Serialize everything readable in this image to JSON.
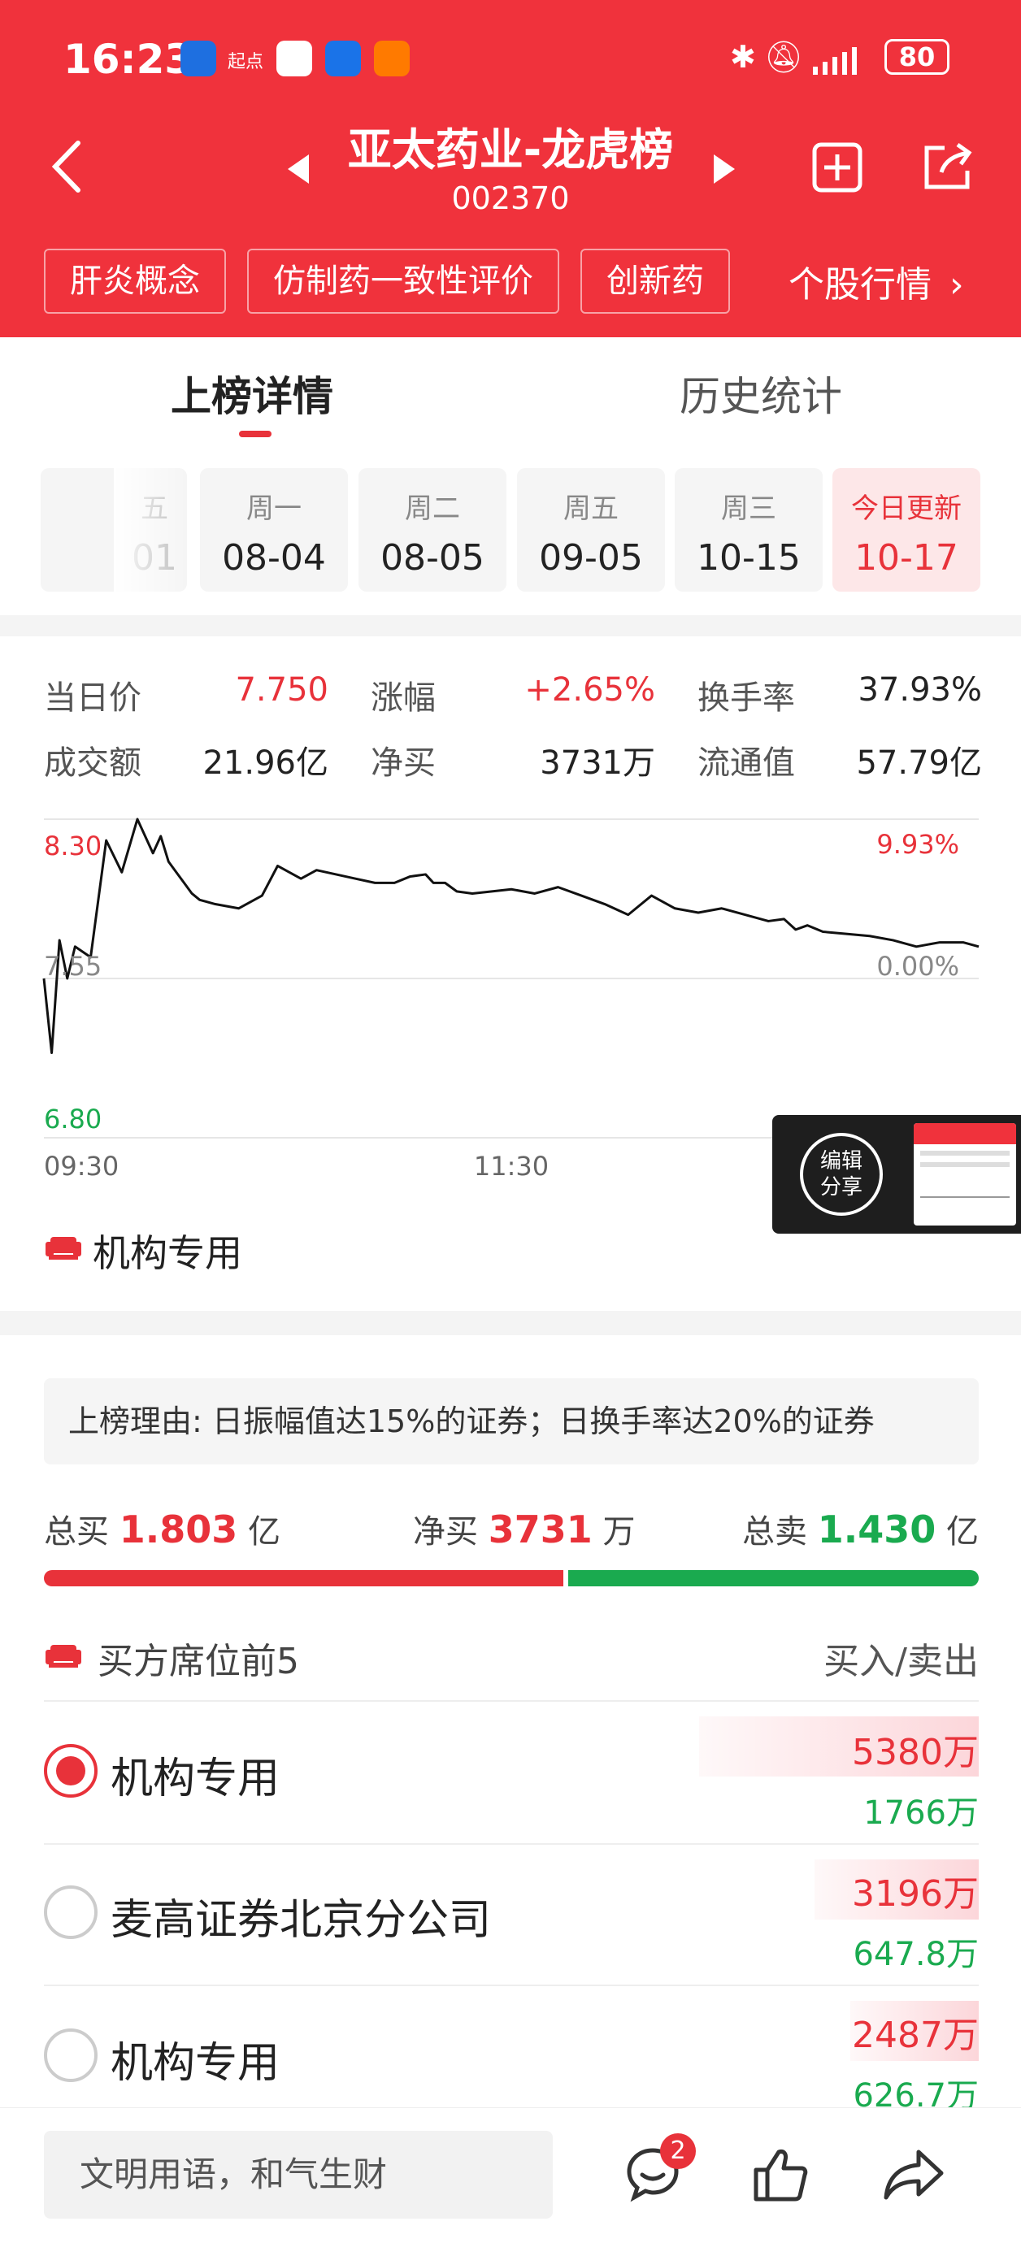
{
  "status_bar": {
    "time": "16:23",
    "app_icon_text": "起点",
    "battery": "80"
  },
  "header": {
    "title": "亚太药业-龙虎榜",
    "code": "002370",
    "tags": [
      "肝炎概念",
      "仿制药一致性评价",
      "创新药"
    ],
    "quote_link": "个股行情"
  },
  "tabs": [
    {
      "label": "上榜详情",
      "active": true
    },
    {
      "label": "历史统计",
      "active": false
    }
  ],
  "dates": [
    {
      "weekday": "五",
      "date": "01",
      "partial": true
    },
    {
      "weekday": "周一",
      "date": "08-04"
    },
    {
      "weekday": "周二",
      "date": "08-05"
    },
    {
      "weekday": "周五",
      "date": "09-05"
    },
    {
      "weekday": "周三",
      "date": "10-15"
    },
    {
      "weekday": "今日更新",
      "date": "10-17",
      "active": true
    }
  ],
  "stats": [
    {
      "label": "当日价",
      "value": "7.750",
      "color": "#e8323a"
    },
    {
      "label": "涨幅",
      "value": "+2.65%",
      "color": "#e8323a"
    },
    {
      "label": "换手率",
      "value": "37.93%",
      "color": "#222222"
    },
    {
      "label": "成交额",
      "value": "21.96亿",
      "color": "#222222"
    },
    {
      "label": "净买",
      "value": "3731万",
      "color": "#222222"
    },
    {
      "label": "流通值",
      "value": "57.79亿",
      "color": "#222222"
    }
  ],
  "chart_data": {
    "type": "line",
    "y_left_ticks": [
      "8.30",
      "7.55",
      "6.80"
    ],
    "y_right_ticks": [
      "9.93%",
      "0.00%"
    ],
    "x_ticks": [
      "09:30",
      "11:30"
    ],
    "ylim": [
      6.8,
      8.3
    ],
    "x_minutes": [
      0,
      2,
      4,
      6,
      8,
      12,
      16,
      20,
      24,
      28,
      30,
      32,
      34,
      36,
      38,
      40,
      44,
      50,
      56,
      60,
      66,
      70,
      75,
      80,
      85,
      90,
      94,
      98,
      100,
      103,
      106,
      110,
      115,
      120,
      126,
      132,
      138,
      144,
      150,
      156,
      162,
      168,
      174,
      180,
      186,
      190,
      193,
      196,
      200,
      206,
      212,
      218,
      224,
      230,
      236,
      238,
      240
    ],
    "prices": [
      7.55,
      7.2,
      7.73,
      7.55,
      7.7,
      7.65,
      8.2,
      8.05,
      8.3,
      8.14,
      8.22,
      8.1,
      8.05,
      8.0,
      7.95,
      7.92,
      7.9,
      7.88,
      7.94,
      8.08,
      8.02,
      8.06,
      8.04,
      8.02,
      8.0,
      8.0,
      8.03,
      8.04,
      8.0,
      8.0,
      7.96,
      7.95,
      7.96,
      7.97,
      7.95,
      7.98,
      7.94,
      7.9,
      7.85,
      7.94,
      7.88,
      7.86,
      7.88,
      7.85,
      7.82,
      7.83,
      7.78,
      7.8,
      7.77,
      7.76,
      7.75,
      7.73,
      7.7,
      7.72,
      7.72,
      7.71,
      7.7
    ],
    "prev_close": 7.55,
    "series_color": "#111111",
    "grid": true
  },
  "seat_label_top": "机构专用",
  "share_overlay": {
    "label": "编辑\n分享"
  },
  "reason": "上榜理由: 日振幅值达15%的证券；日换手率达20%的证券",
  "summary": {
    "total_buy_label": "总买",
    "total_buy": "1.803",
    "total_buy_unit": "亿",
    "net_buy_label": "净买",
    "net_buy": "3731",
    "net_buy_unit": "万",
    "total_sell_label": "总卖",
    "total_sell": "1.430",
    "total_sell_unit": "亿",
    "buy_ratio": 0.558
  },
  "buyers_header": {
    "title": "买方席位前5",
    "right": "买入/卖出"
  },
  "buyers": [
    {
      "name": "机构专用",
      "buy": "5380万",
      "sell": "1766万",
      "selected": true,
      "bar_ratio": 1.0
    },
    {
      "name": "麦高证券北京分公司",
      "buy": "3196万",
      "sell": "647.8万",
      "selected": false,
      "bar_ratio": 0.59
    },
    {
      "name": "机构专用",
      "buy": "2487万",
      "sell": "626.7万",
      "selected": false,
      "bar_ratio": 0.46
    }
  ],
  "bottom_bar": {
    "input_placeholder": "文明用语，和气生财",
    "comment_count": "2"
  }
}
